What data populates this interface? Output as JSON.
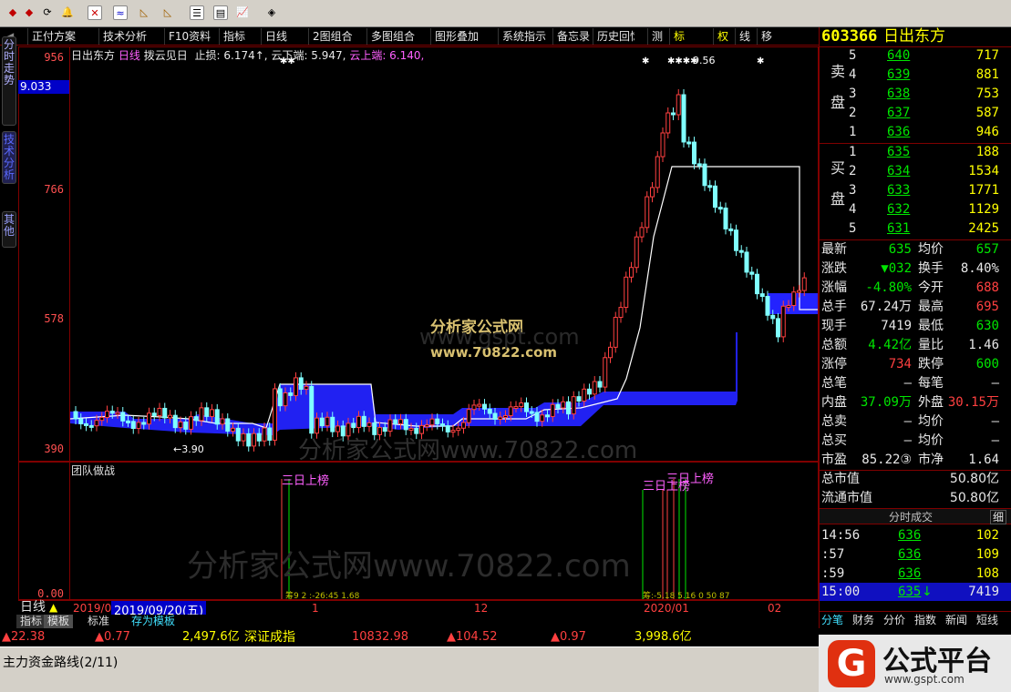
{
  "iconbar": {
    "icons": [
      "diamond-left-icon",
      "diamond-right-icon",
      "refresh-icon",
      "bell-icon",
      "chart-red-icon",
      "chart-line-icon",
      "draw-tool-icon",
      "draw-tool2-icon",
      "measure-icon",
      "list-icon",
      "news-icon",
      "analysis-icon",
      "formula-icon",
      "help-icon"
    ]
  },
  "toolbar": {
    "items": [
      "正付方案",
      "技术分析",
      "F10资料",
      "指标",
      "日线",
      "2图组合",
      "多图组合",
      "图形叠加",
      "系统指示",
      "备忘录",
      "历史回忆",
      "测",
      "标",
      "权",
      "线",
      "移"
    ]
  },
  "left_tabs": {
    "tab1": "分时走势",
    "tab2": "技术分析",
    "tab3": "其他"
  },
  "main_chart": {
    "title_name": "日出东方",
    "title_period": "日线",
    "title_formula": "拨云见日",
    "stop_label": "止损: 6.174↑,",
    "cloud_low": "云下端: 5.947,",
    "cloud_high": "云上端: 6.140,",
    "y_ticks": [
      "956",
      "766",
      "578",
      "390"
    ],
    "price_box": "9.033",
    "high_marker": "9.56",
    "low_marker": "←3.90",
    "watermark1": "分析家公式网",
    "watermark2": "www.70822.com",
    "watermark3": "分析家公式网www.70822.com",
    "watermark4": "www.gspt.com"
  },
  "sub_chart": {
    "title": "团队做战",
    "label1": "三日上榜",
    "label2": "三日上榜",
    "label3": "三日上榜",
    "y_tick": "0.00",
    "watermark": "分析家公式网www.70822.com",
    "small_a": "筹9 2 :-26:45 1.68",
    "small_b": "筹:-5.18 5.16 0 50 87"
  },
  "xaxis": {
    "period": "日线",
    "date_left": "2019/0",
    "date_cursor": "2019/09/20(五)",
    "ticks": [
      "1",
      "12",
      "2020/01",
      "02"
    ]
  },
  "bottom_tabs": [
    "指标",
    "模板",
    "标准",
    "存为模板"
  ],
  "index_bar": {
    "v1": "▲22.38",
    "v2": "▲0.77",
    "amt1": "2,497.6亿",
    "name": "深证成指",
    "price": "10832.98",
    "chg": "▲104.52",
    "pct": "▲0.97",
    "amt2": "3,998.6亿"
  },
  "status_bar": {
    "text": "主力资金路线(2/11)"
  },
  "right_panel": {
    "code": "603366",
    "name": "日出东方",
    "sell_label": "卖盘",
    "buy_label": "买盘",
    "asks": [
      {
        "lvl": "5",
        "price": "640",
        "vol": "717"
      },
      {
        "lvl": "4",
        "price": "639",
        "vol": "881"
      },
      {
        "lvl": "3",
        "price": "638",
        "vol": "753"
      },
      {
        "lvl": "2",
        "price": "637",
        "vol": "587"
      },
      {
        "lvl": "1",
        "price": "636",
        "vol": "946"
      }
    ],
    "bids": [
      {
        "lvl": "1",
        "price": "635",
        "vol": "188"
      },
      {
        "lvl": "2",
        "price": "634",
        "vol": "1534"
      },
      {
        "lvl": "3",
        "price": "633",
        "vol": "1771"
      },
      {
        "lvl": "4",
        "price": "632",
        "vol": "1129"
      },
      {
        "lvl": "5",
        "price": "631",
        "vol": "2425"
      }
    ],
    "stats": [
      {
        "l1": "最新",
        "v1": "635",
        "c1": "green",
        "l2": "均价",
        "v2": "657",
        "c2": "green"
      },
      {
        "l1": "涨跌",
        "v1": "▼032",
        "c1": "green",
        "l2": "换手",
        "v2": "8.40%",
        "c2": "white"
      },
      {
        "l1": "涨幅",
        "v1": "-4.80%",
        "c1": "green",
        "l2": "今开",
        "v2": "688",
        "c2": "red"
      },
      {
        "l1": "总手",
        "v1": "67.24万",
        "c1": "white",
        "l2": "最高",
        "v2": "695",
        "c2": "red"
      },
      {
        "l1": "现手",
        "v1": "7419",
        "c1": "white",
        "l2": "最低",
        "v2": "630",
        "c2": "green"
      },
      {
        "l1": "总额",
        "v1": "4.42亿",
        "c1": "green",
        "l2": "量比",
        "v2": "1.46",
        "c2": "white"
      },
      {
        "l1": "涨停",
        "v1": "734",
        "c1": "red",
        "l2": "跌停",
        "v2": "600",
        "c2": "green"
      },
      {
        "l1": "总笔",
        "v1": "–",
        "c1": "white",
        "l2": "每笔",
        "v2": "–",
        "c2": "white"
      },
      {
        "l1": "内盘",
        "v1": "37.09万",
        "c1": "green",
        "l2": "外盘",
        "v2": "30.15万",
        "c2": "red"
      },
      {
        "l1": "总卖",
        "v1": "–",
        "c1": "white",
        "l2": "均价",
        "v2": "–",
        "c2": "white"
      },
      {
        "l1": "总买",
        "v1": "–",
        "c1": "white",
        "l2": "均价",
        "v2": "–",
        "c2": "white"
      },
      {
        "l1": "市盈",
        "v1": "85.22③",
        "c1": "white",
        "l2": "市净",
        "v2": "1.64",
        "c2": "white"
      }
    ],
    "market_cap_label": "总市值",
    "market_cap": "50.80亿",
    "float_cap_label": "流通市值",
    "float_cap": "50.80亿",
    "ticks_title": "分时成交",
    "ticks_detail": "细",
    "ticks": [
      {
        "time": "14:56",
        "price": "636",
        "vol": "102"
      },
      {
        "time": ":57",
        "price": "636",
        "vol": "109"
      },
      {
        "time": ":59",
        "price": "636",
        "vol": "108"
      }
    ],
    "last_tick": {
      "time": "15:00",
      "price": "635",
      "arrow": "↓",
      "vol": "7419"
    },
    "bottom_tabs": [
      "分笔",
      "财务",
      "分价",
      "指数",
      "新闻",
      "短线"
    ]
  },
  "logo": {
    "text": "公式平台",
    "url_text": "www.gspt.com"
  },
  "colors": {
    "up": "#ff4040",
    "down": "#00e600",
    "cloud": "#2020ff",
    "frame": "#800000",
    "cyan": "#80ffff"
  }
}
